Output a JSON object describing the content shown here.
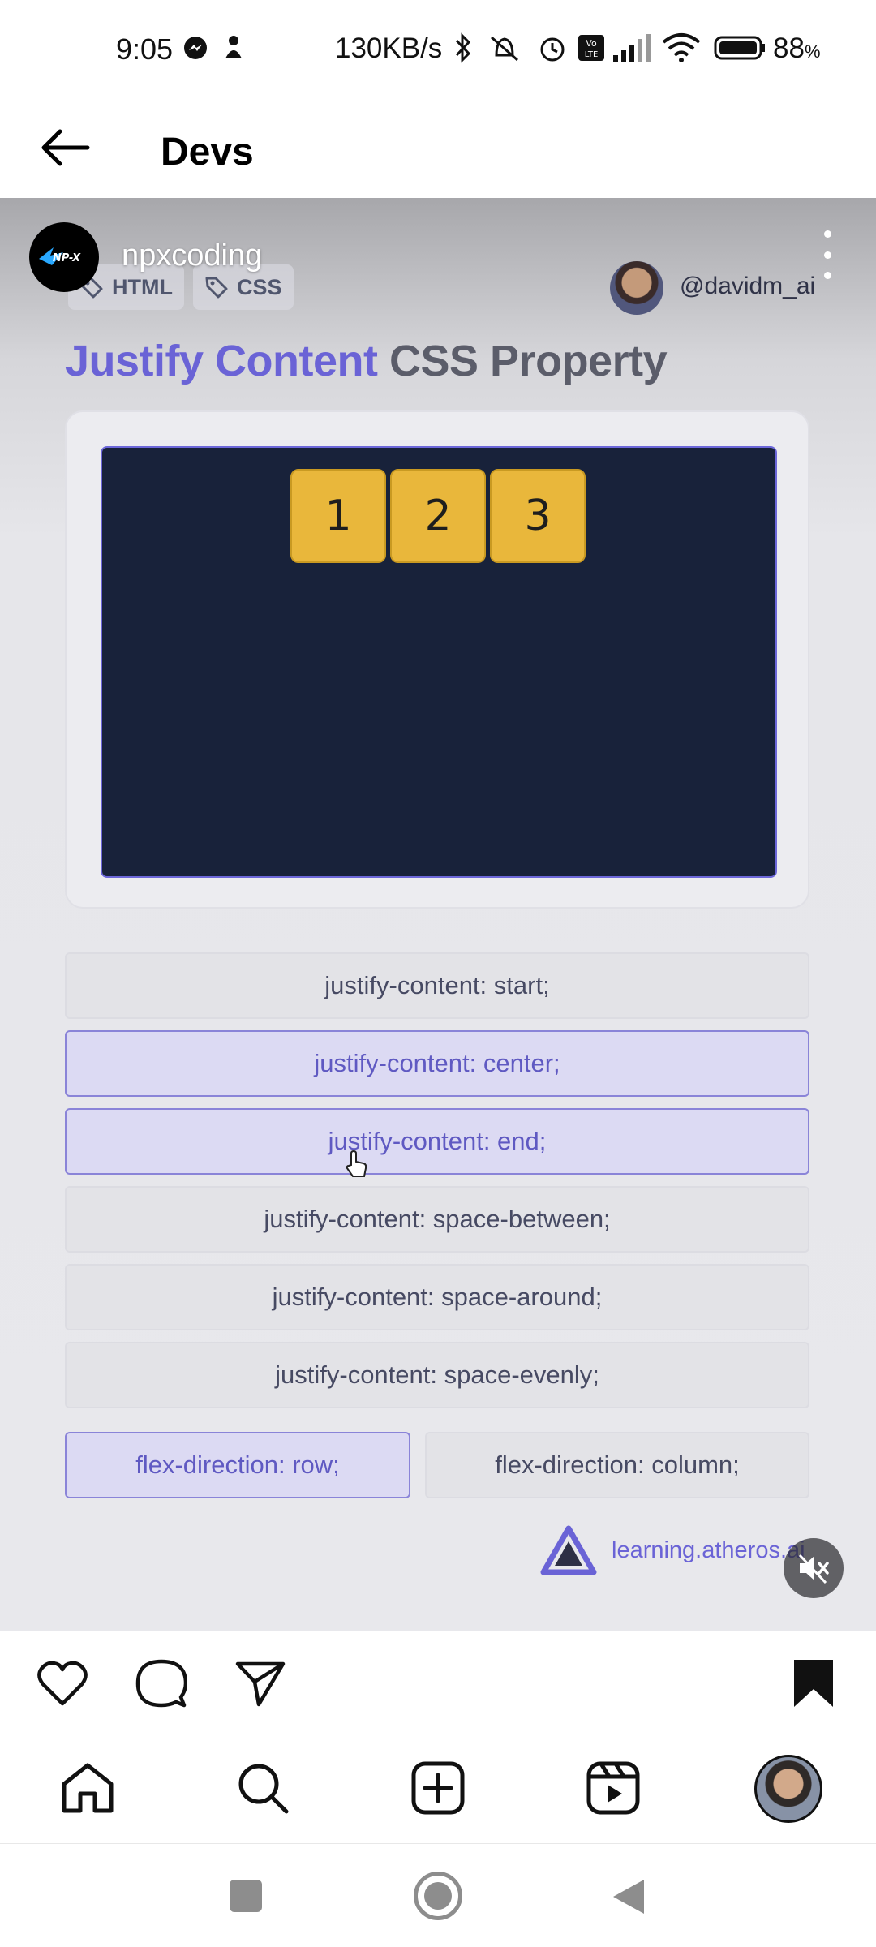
{
  "status_bar": {
    "time": "9:05",
    "network_speed": "130KB/s",
    "battery": "88",
    "battery_unit": "%"
  },
  "header": {
    "title": "Devs"
  },
  "post": {
    "username": "npxcoding",
    "avatar_text": "NP-X",
    "video": {
      "tags": [
        "HTML",
        "CSS"
      ],
      "creator_handle": "@davidm_ai",
      "title_accent": "Justify Content",
      "title_rest": " CSS Property",
      "boxes": [
        "1",
        "2",
        "3"
      ],
      "options": [
        {
          "label": "justify-content: start;",
          "state": "normal"
        },
        {
          "label": "justify-content: center;",
          "state": "active"
        },
        {
          "label": "justify-content: end;",
          "state": "active"
        },
        {
          "label": "justify-content: space-between;",
          "state": "normal"
        },
        {
          "label": "justify-content: space-around;",
          "state": "normal"
        },
        {
          "label": "justify-content: space-evenly;",
          "state": "normal"
        }
      ],
      "direction_options": [
        {
          "label": "flex-direction: row;",
          "state": "active"
        },
        {
          "label": "flex-direction: column;",
          "state": "normal"
        }
      ],
      "brand": "learning.atheros.ai"
    }
  },
  "icons": {
    "back": "arrow-left-icon",
    "like": "heart-icon",
    "comment": "comment-icon",
    "share": "paper-plane-icon",
    "save": "bookmark-icon",
    "mute": "speaker-muted-icon",
    "home": "home-icon",
    "search": "search-icon",
    "create": "plus-square-icon",
    "reels": "reels-icon"
  },
  "colors": {
    "accent": "#6a63d6",
    "canvas": "#18223a",
    "box": "#e9b73b"
  }
}
